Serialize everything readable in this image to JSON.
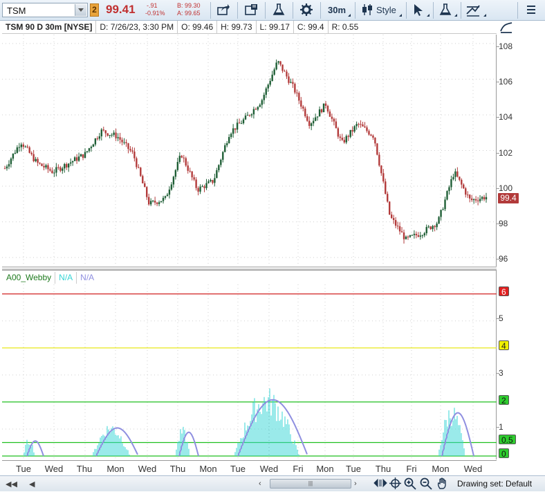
{
  "toolbar": {
    "symbol": "TSM",
    "link_group": "2",
    "last_price": "99.41",
    "net_change": "-.91",
    "pct_change": "-0.91%",
    "bid": "B: 99.30",
    "ask": "A: 99.65",
    "aggregation": "30m",
    "style_label": "Style",
    "icons": [
      "share-icon",
      "flag-icon",
      "flask-icon",
      "gear-icon",
      "candle-icon",
      "cursor-icon",
      "flask-icon",
      "drawing-icon",
      "menu-icon"
    ]
  },
  "header": {
    "title": "TSM 90 D 30m [NYSE]",
    "date": "D: 7/26/23, 3:30 PM",
    "open": "O: 99.46",
    "high": "H: 99.73",
    "low": "L: 99.17",
    "close": "C: 99.4",
    "range": "R: 0.55"
  },
  "indicator": {
    "name": "A00_Webby",
    "value1": "N/A",
    "value2": "N/A",
    "levels": [
      "6",
      "5",
      "4",
      "3",
      "2",
      "1",
      "0.5",
      "0"
    ]
  },
  "colors": {
    "bull": "#1e5e35",
    "bear": "#b23a3a",
    "cyan": "#36d4d4",
    "lavender": "#8f8fe0",
    "level_red": "#d02020",
    "level_yellow": "#e6e600",
    "level_green": "#1fbf1f"
  },
  "price_axis": {
    "ticks": [
      "108",
      "106",
      "104",
      "102",
      "100",
      "98",
      "96"
    ],
    "current_price_tag": "99.4"
  },
  "x_axis": {
    "labels": [
      "Tue",
      "Wed",
      "Thu",
      "Mon",
      "Wed",
      "Thu",
      "Mon",
      "Tue",
      "Wed",
      "Fri",
      "Mon",
      "Tue",
      "Thu",
      "Fri",
      "Mon",
      "Wed"
    ]
  },
  "bottom": {
    "drawing_set": "Drawing set: Default"
  },
  "chart_data": {
    "type": "line",
    "price_series_approx": [
      {
        "x": "Tue",
        "y": 101.0
      },
      {
        "x": "Tue",
        "y": 102.5
      },
      {
        "x": "Wed",
        "y": 101.3
      },
      {
        "x": "Wed",
        "y": 100.8
      },
      {
        "x": "Thu",
        "y": 101.3
      },
      {
        "x": "Thu",
        "y": 101.8
      },
      {
        "x": "Mon",
        "y": 103.1
      },
      {
        "x": "Mon",
        "y": 102.8
      },
      {
        "x": "Wed",
        "y": 101.8
      },
      {
        "x": "Wed",
        "y": 99.0
      },
      {
        "x": "Thu",
        "y": 99.3
      },
      {
        "x": "Thu",
        "y": 101.8
      },
      {
        "x": "Mon",
        "y": 99.8
      },
      {
        "x": "Mon",
        "y": 100.3
      },
      {
        "x": "Tue",
        "y": 103.0
      },
      {
        "x": "Tue",
        "y": 103.8
      },
      {
        "x": "Wed",
        "y": 104.8
      },
      {
        "x": "Wed",
        "y": 107.0
      },
      {
        "x": "Fri",
        "y": 105.5
      },
      {
        "x": "Fri",
        "y": 103.5
      },
      {
        "x": "Mon",
        "y": 104.6
      },
      {
        "x": "Mon",
        "y": 102.4
      },
      {
        "x": "Tue",
        "y": 103.5
      },
      {
        "x": "Tue",
        "y": 102.8
      },
      {
        "x": "Thu",
        "y": 98.3
      },
      {
        "x": "Thu",
        "y": 97.0
      },
      {
        "x": "Fri",
        "y": 97.4
      },
      {
        "x": "Mon",
        "y": 98.0
      },
      {
        "x": "Mon",
        "y": 100.8
      },
      {
        "x": "Wed",
        "y": 99.2
      },
      {
        "x": "Wed",
        "y": 99.4
      }
    ],
    "ylim": [
      95.5,
      108.5
    ],
    "indicator_ylim": [
      0,
      6.3
    ],
    "levels": [
      6,
      4,
      2,
      0.5,
      0
    ]
  }
}
